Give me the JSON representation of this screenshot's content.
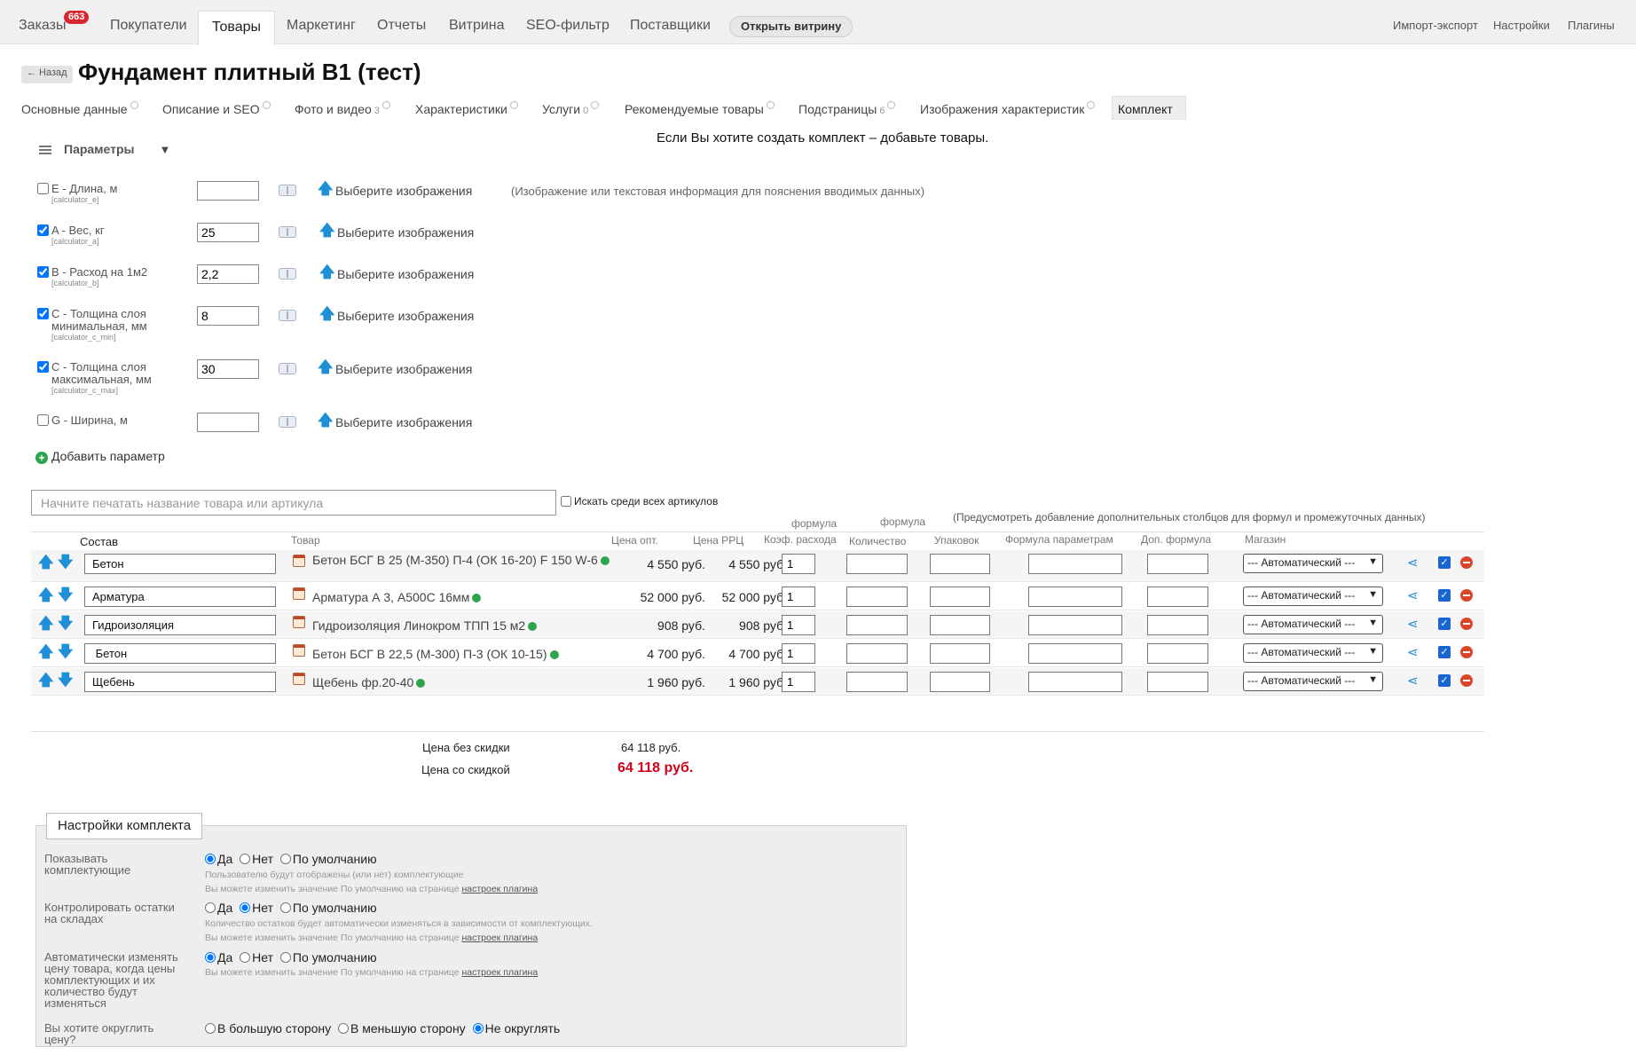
{
  "nav": {
    "tabs": [
      {
        "label": "Заказы"
      },
      {
        "label": "Покупатели"
      },
      {
        "label": "Товары"
      },
      {
        "label": "Маркетинг"
      },
      {
        "label": "Отчеты"
      },
      {
        "label": "Витрина"
      },
      {
        "label": "SEO-фильтр"
      },
      {
        "label": "Поставщики"
      }
    ],
    "orders_badge": "663",
    "open_store": "Открыть витрину",
    "right_links": [
      "Импорт-экспорт",
      "Настройки",
      "Плагины"
    ]
  },
  "header": {
    "back": "← Назад",
    "title": "Фундамент плитный B1 (тест)"
  },
  "subtabs": [
    {
      "label": "Основные данные",
      "count": ""
    },
    {
      "label": "Описание и SEO",
      "count": ""
    },
    {
      "label": "Фото и видео",
      "count": "3"
    },
    {
      "label": "Характеристики",
      "count": ""
    },
    {
      "label": "Услуги",
      "count": "0"
    },
    {
      "label": "Рекомендуемые товары",
      "count": ""
    },
    {
      "label": "Подстраницы",
      "count": "6"
    },
    {
      "label": "Изображения характеристик",
      "count": ""
    },
    {
      "label": "Комплект",
      "count": ""
    }
  ],
  "hint_top": "Если Вы хотите создать комплект – добавьте товары.",
  "params": {
    "title": "Параметры",
    "rows": [
      {
        "label": "E - Длина, м",
        "code": "[calculator_e]",
        "value": "",
        "checked": false,
        "select": "Выберите изображения"
      },
      {
        "label": "A - Вес, кг",
        "code": "[calculator_a]",
        "value": "25",
        "checked": true,
        "select": "Выберите изображения"
      },
      {
        "label": "B - Расход на 1м2",
        "code": "[calculator_b]",
        "value": "2,2",
        "checked": true,
        "select": "Выберите изображения"
      },
      {
        "label": "C - Толщина слоя минимальная, мм",
        "code": "[calculator_c_min]",
        "value": "8",
        "checked": true,
        "select": "Выберите изображения"
      },
      {
        "label": "C - Толщина слоя максимальная, мм",
        "code": "[calculator_c_max]",
        "value": "30",
        "checked": true,
        "select": "Выберите изображения"
      },
      {
        "label": "G - Ширина, м",
        "code": "",
        "value": "",
        "checked": false,
        "select": "Выберите изображения"
      }
    ],
    "note": "(Изображение или текстовая информация для пояснения вводимых данных)",
    "add": "Добавить параметр"
  },
  "search": {
    "placeholder": "Начните печатать название товара или артикула",
    "all_articles": "Искать среди всех артикулов"
  },
  "table": {
    "columns_note": "(Предусмотреть добавление дополнительных столбцов для формул и промежуточных данных)",
    "formula_a": "формула",
    "formula_b": "формула",
    "headers": {
      "sostav": "Состав",
      "tovar": "Товар",
      "price_opt": "Цена опт.",
      "price_rrc": "Цена РРЦ",
      "koef": "Коэф. расхода",
      "qty": "Количество",
      "pack": "Упаковок",
      "formula_params": "Формула  параметрам",
      "dop_formula": "Доп. формула",
      "shop": "Магазин"
    },
    "rows": [
      {
        "component": "Бетон",
        "product": "Бетон БСГ В 25 (М-350) П-4 (ОК 16-20) F 150 W-6",
        "price_opt": "4 550 руб.",
        "price_rrc": "4 550 руб.",
        "koef": "1",
        "shop": "--- Автоматический ---"
      },
      {
        "component": "Арматура",
        "product": "Арматура А 3, А500С 16мм",
        "price_opt": "52 000 руб.",
        "price_rrc": "52 000 руб.",
        "koef": "1",
        "shop": "--- Автоматический ---"
      },
      {
        "component": "Гидроизоляция",
        "product": "Гидроизоляция Линокром ТПП 15 м2",
        "price_opt": "908 руб.",
        "price_rrc": "908 руб.",
        "koef": "1",
        "shop": "--- Автоматический ---"
      },
      {
        "component": " Бетон",
        "product": "Бетон БСГ В 22,5 (М-300) П-3 (ОК 10-15)",
        "price_opt": "4 700 руб.",
        "price_rrc": "4 700 руб.",
        "koef": "1",
        "shop": "--- Автоматический ---"
      },
      {
        "component": "Щебень",
        "product": "Щебень фр.20-40",
        "price_opt": "1 960 руб.",
        "price_rrc": "1 960 руб.",
        "koef": "1",
        "shop": "--- Автоматический ---"
      }
    ]
  },
  "totals": {
    "no_discount_label": "Цена без скидки",
    "no_discount_value": "64 118 руб.",
    "with_discount_label": "Цена со скидкой",
    "with_discount_value": "64 118 руб."
  },
  "settings": {
    "legend": "Настройки комплекта",
    "show": {
      "label": "Показывать комплектующие",
      "options": [
        "Да",
        "Нет",
        "По умолчанию"
      ],
      "hint1": "Пользователю будут отображены (или нет) комплектующие",
      "hint2": "Вы можете изменить значение По умолчанию на странице",
      "link": "настроек плагина"
    },
    "stock": {
      "label": "Контролировать остатки на складах",
      "options": [
        "Да",
        "Нет",
        "По умолчанию"
      ],
      "hint1": "Количество остатков будет автоматически изменяться в зависимости от комплектующих.",
      "hint2": "Вы можете изменить значение По умолчанию на странице",
      "link": "настроек плагина"
    },
    "auto_price": {
      "label": "Автоматически изменять цену товара, когда цены комплектующих и их количество будут изменяться",
      "options": [
        "Да",
        "Нет",
        "По умолчанию"
      ],
      "hint2": "Вы можете изменить значение По умолчанию на странице",
      "link": "настроек плагина"
    },
    "round": {
      "label": "Вы хотите округлить цену?",
      "options": [
        "В большую сторону",
        "В меньшую сторону",
        "Не округлять"
      ]
    }
  },
  "colors": {
    "accent_blue": "#1f8fd6",
    "badge_red": "#d9272d",
    "discount_red": "#d0021b",
    "ok_green": "#2da44e"
  }
}
